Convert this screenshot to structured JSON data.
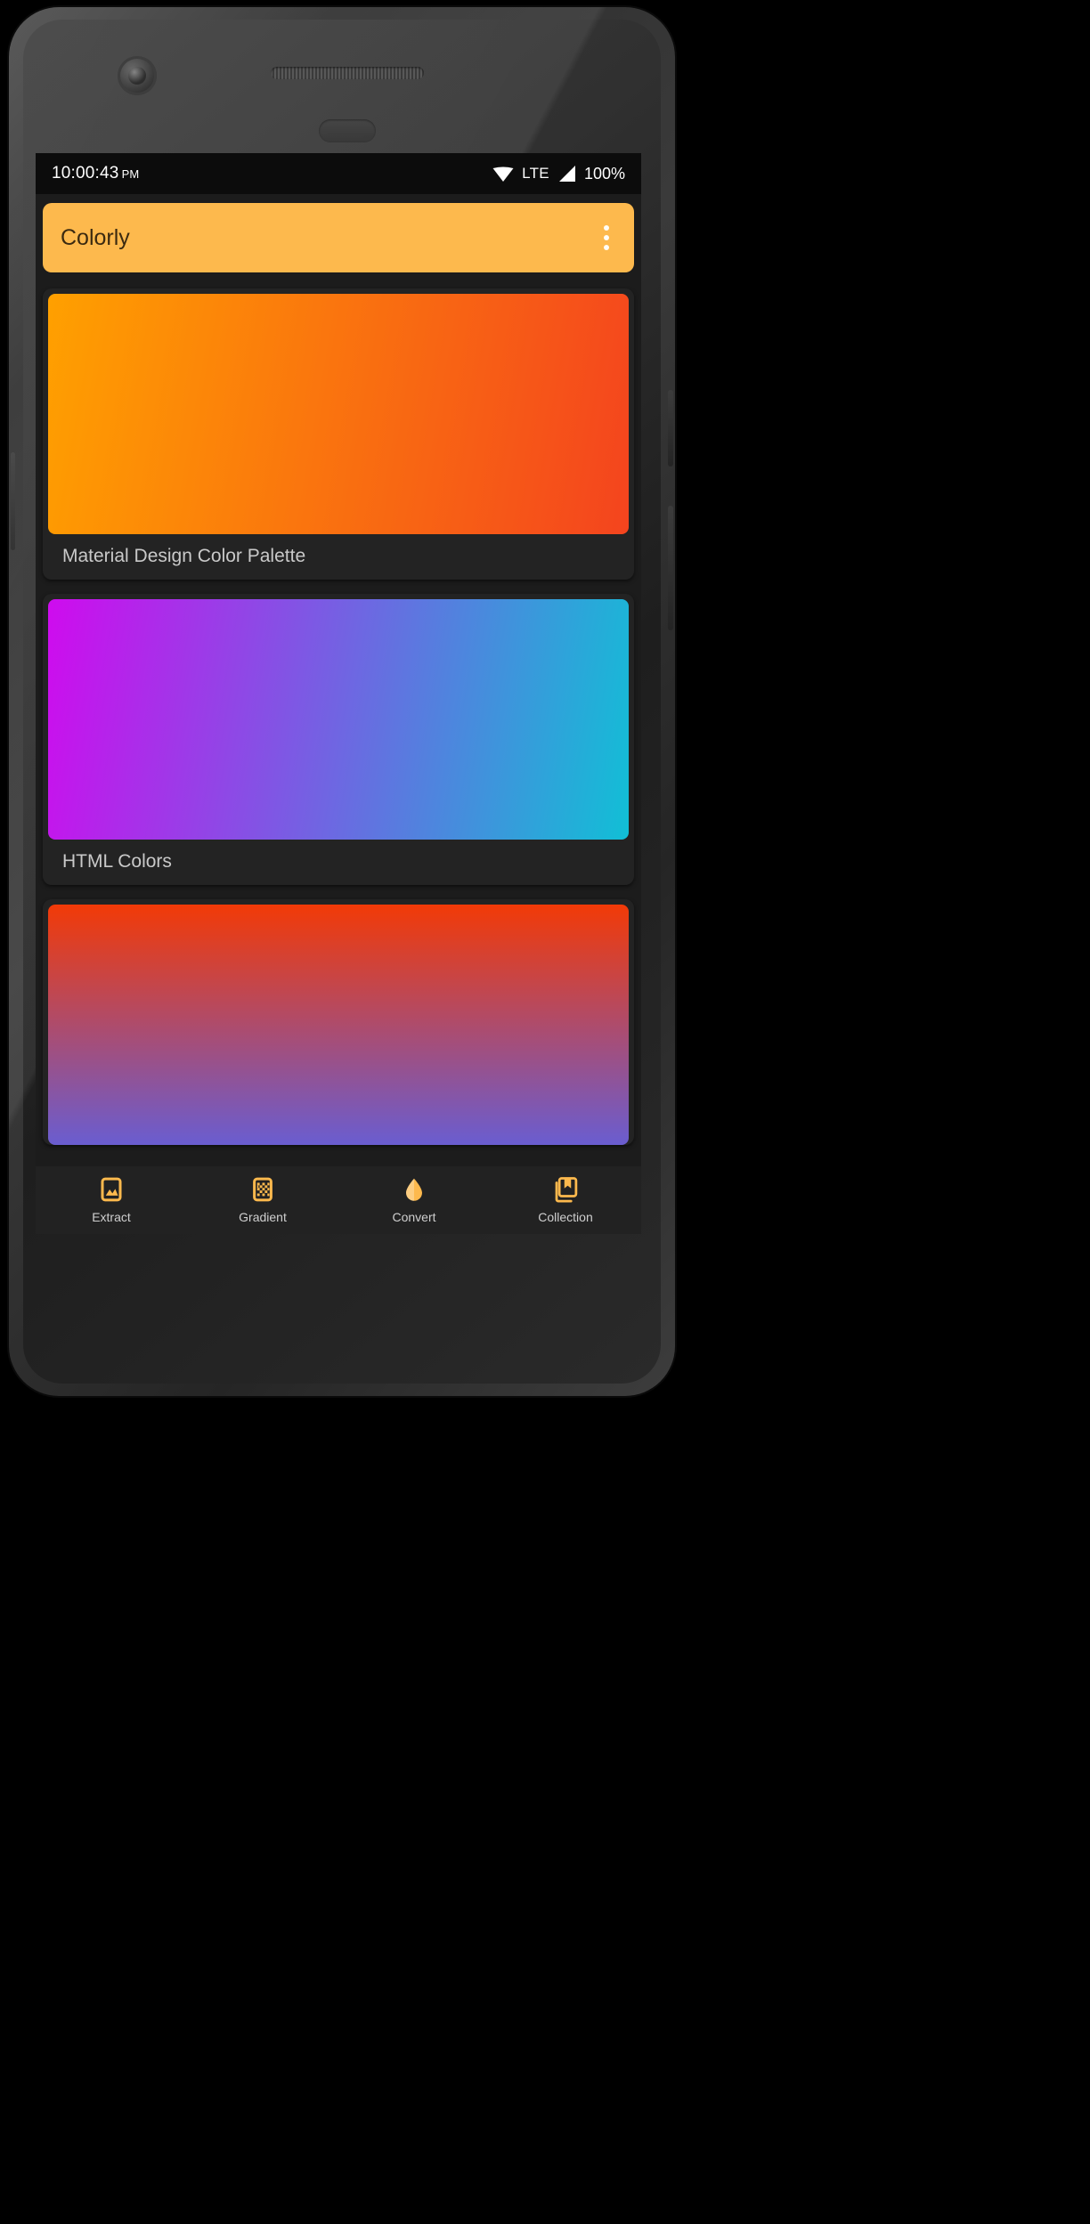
{
  "status_bar": {
    "time": "10:00:43",
    "am_pm": "PM",
    "network": "LTE",
    "battery": "100%",
    "wifi_icon": "wifi-icon",
    "signal_icon": "signal-bars-icon"
  },
  "app_bar": {
    "title": "Colorly",
    "overflow_icon": "more-vert-icon",
    "background_color": "#FDB94D",
    "title_color": "#3B2A10"
  },
  "palettes": [
    {
      "label": "Material Design Color Palette",
      "gradient_from": "#FFA000",
      "gradient_to": "#F4441E"
    },
    {
      "label": "HTML Colors",
      "gradient_from": "#CF0BEE",
      "gradient_to": "#11BFD6"
    },
    {
      "label": "",
      "gradient_from": "#F23A07",
      "gradient_to": "#6A5DD0"
    }
  ],
  "bottom_nav": [
    {
      "label": "Extract",
      "icon": "image-photo-icon"
    },
    {
      "label": "Gradient",
      "icon": "gradient-checker-icon"
    },
    {
      "label": "Convert",
      "icon": "water-drop-icon"
    },
    {
      "label": "Collection",
      "icon": "collections-bookmark-icon"
    }
  ],
  "theme": {
    "accent": "#FDB94D",
    "screen_background": "#1C1C1C",
    "card_background": "#232323",
    "nav_background": "#222222",
    "label_color": "#C9C9C9"
  }
}
